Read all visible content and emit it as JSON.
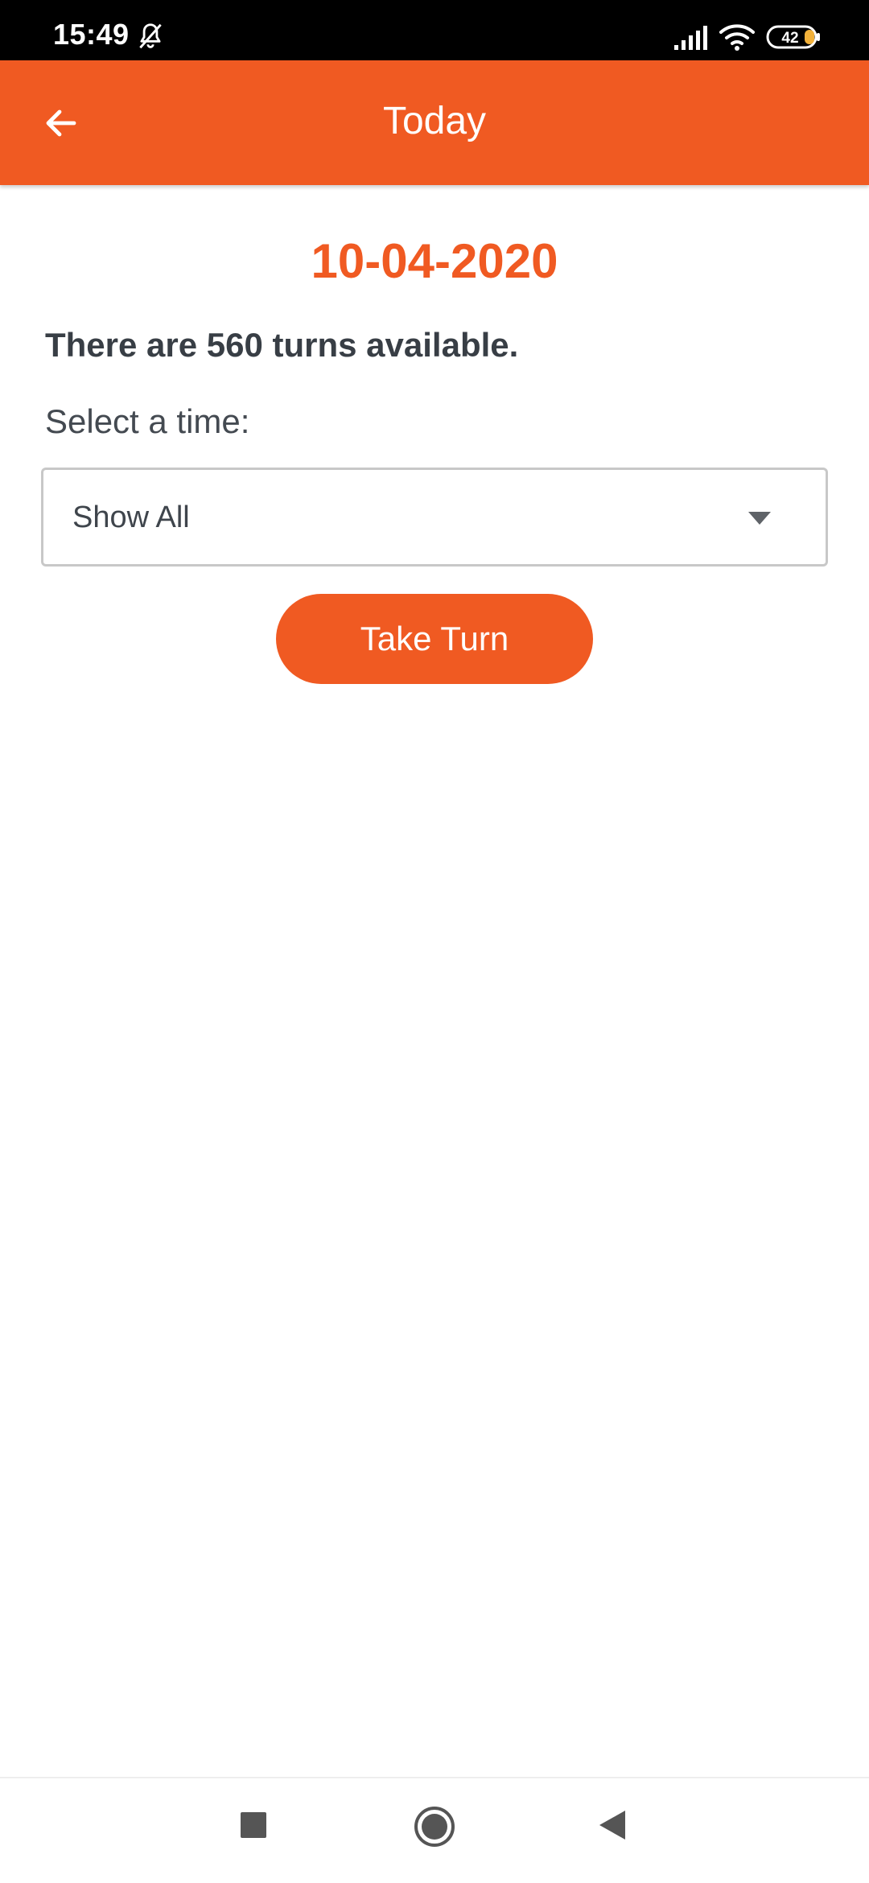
{
  "status_bar": {
    "time": "15:49",
    "battery": "42",
    "icons": [
      "bell-off-icon",
      "signal-icon",
      "wifi-icon",
      "battery-icon"
    ]
  },
  "app_bar": {
    "title": "Today",
    "back_icon": "arrow-left-icon"
  },
  "content": {
    "date": "10-04-2020",
    "turns_message": "There are 560 turns available.",
    "select_label": "Select a time:",
    "time_select": {
      "selected": "Show All",
      "caret_icon": "caret-down-icon"
    },
    "take_turn_label": "Take Turn"
  },
  "nav_bar": {
    "icons": [
      "recents-square-icon",
      "home-circle-icon",
      "back-triangle-icon"
    ]
  },
  "colors": {
    "accent": "#f05a22",
    "text_dark": "#383e45",
    "border": "#c8c8c8"
  }
}
